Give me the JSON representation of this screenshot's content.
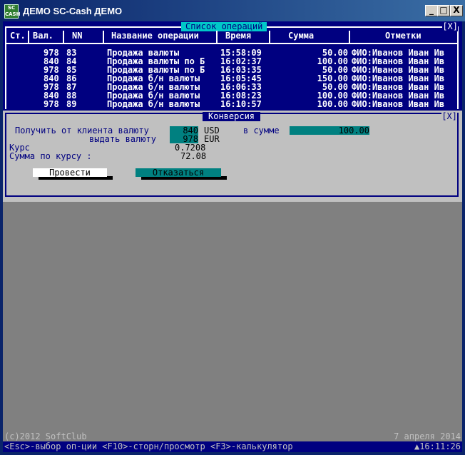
{
  "window": {
    "title": "ДЕМО SC-Cash ДЕМО",
    "icon_text": "SC CASH",
    "minimize": "_",
    "maximize": "□",
    "close": "X"
  },
  "ops": {
    "title": "Список операций",
    "close": "[X]",
    "columns": [
      "Ст.",
      "Вал.",
      "NN",
      "Название операции",
      "Время",
      "Сумма",
      "Отметки"
    ],
    "rows": [
      {
        "cur": "978",
        "nn": "83",
        "name": "Продажа валюты",
        "time": "15:58:09",
        "sum": "50.00",
        "note": "ФИО:Иванов Иван Ив"
      },
      {
        "cur": "840",
        "nn": "84",
        "name": "Продажа валюты по Б",
        "time": "16:02:37",
        "sum": "100.00",
        "note": "ФИО:Иванов Иван Ив"
      },
      {
        "cur": "978",
        "nn": "85",
        "name": "Продажа валюты по Б",
        "time": "16:03:35",
        "sum": "50.00",
        "note": "ФИО:Иванов Иван Ив"
      },
      {
        "cur": "840",
        "nn": "86",
        "name": "Продажа б/н валюты",
        "time": "16:05:45",
        "sum": "150.00",
        "note": "ФИО:Иванов Иван Ив"
      },
      {
        "cur": "978",
        "nn": "87",
        "name": "Продажа б/н валюты",
        "time": "16:06:33",
        "sum": "50.00",
        "note": "ФИО:Иванов Иван Ив"
      },
      {
        "cur": "840",
        "nn": "88",
        "name": "Продажа б/н валюты",
        "time": "16:08:23",
        "sum": "100.00",
        "note": "ФИО:Иванов Иван Ив"
      },
      {
        "cur": "978",
        "nn": "89",
        "name": "Продажа б/н валюты",
        "time": "16:10:57",
        "sum": "100.00",
        "note": "ФИО:Иванов Иван Ив"
      }
    ]
  },
  "conv": {
    "title": "Конверсия",
    "close": "[X]",
    "get_label": "Получить от клиента валюту",
    "get_code": "840",
    "get_iso": "USD",
    "amount_label": "в сумме",
    "amount": "100.00",
    "give_label": "выдать валюту",
    "give_code": "978",
    "give_iso": "EUR",
    "rate_label": "Курс",
    "rate": "0.7208",
    "sum_label": "Сумма по курсу :",
    "sum": "72.08",
    "ok_label": "Провести",
    "cancel_label": "Отказаться"
  },
  "status": {
    "copyright": "(c)2012 SoftClub",
    "date": "7 апреля 2014",
    "hints": "<Esc>-выбор оп-ции <F10>-сторн/просмотр <F3>-калькулятор",
    "clock": "▲16:11:26"
  },
  "colors": {
    "list_bg": "#000080",
    "highlight": "#00c8c8",
    "field": "#008080",
    "panel": "#c0c0c0"
  }
}
